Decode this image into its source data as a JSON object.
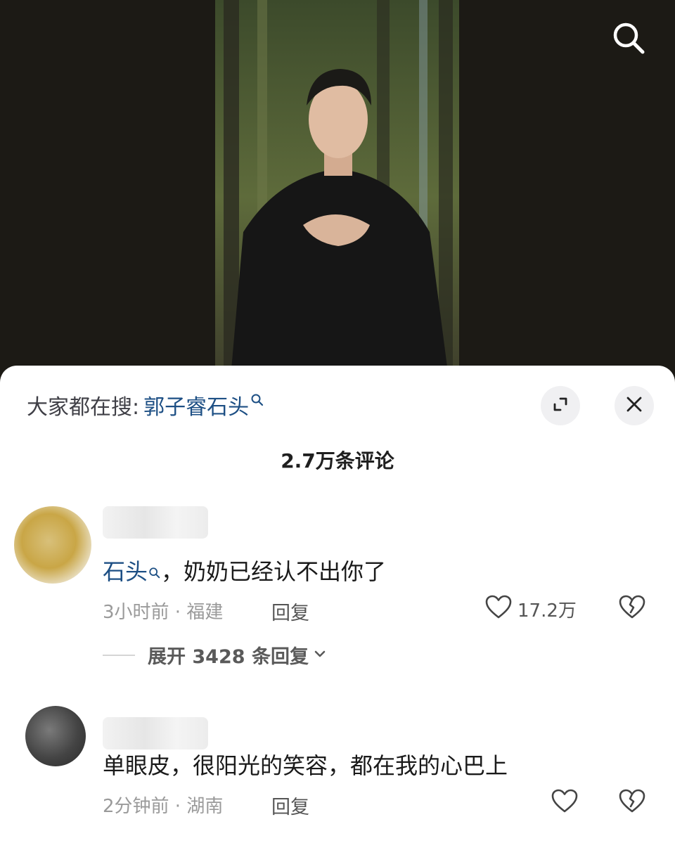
{
  "hot_search": {
    "prefix": "大家都在搜:",
    "term": "郭子睿石头"
  },
  "comments_header": {
    "title": "2.7万条评论"
  },
  "comments": [
    {
      "mention": "石头",
      "text": "，奶奶已经认不出你了",
      "time_location": "3小时前 · 福建",
      "reply_label": "回复",
      "like_count": "17.2万",
      "expand_label": "展开 3428 条回复"
    },
    {
      "text": "单眼皮，很阳光的笑容，都在我的心巴上",
      "time_location": "2分钟前 · 湖南",
      "reply_label": "回复"
    }
  ],
  "icons": {
    "search": "search-icon",
    "expand": "expand-icon",
    "close": "close-icon",
    "like": "heart-icon",
    "dislike": "broken-heart-icon",
    "chevron": "chevron-down-icon"
  },
  "colors": {
    "link": "#1d4f84",
    "video_bg": "#1c1a15",
    "sheet_bg": "#ffffff"
  }
}
